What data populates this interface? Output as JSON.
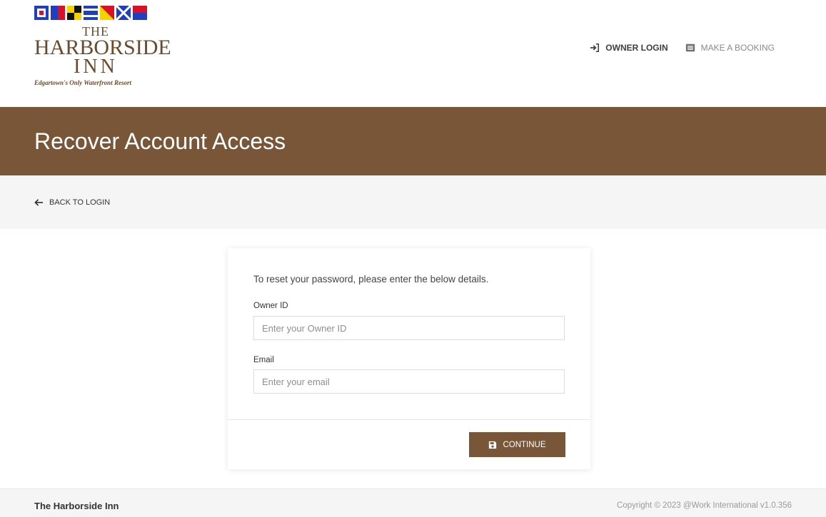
{
  "colors": {
    "brand": "#7a5638",
    "text": "#333333",
    "muted": "#8a8a8a",
    "backbar": "#f5f5f5"
  },
  "logo": {
    "line_the": "THE",
    "line_name": "HARBORSIDE",
    "line_inn": "INN",
    "tagline": "Edgartown's Only Waterfront Resort"
  },
  "nav": {
    "owner_login": {
      "label": "OWNER LOGIN",
      "icon": "sign-in-icon"
    },
    "make_booking": {
      "label": "MAKE A BOOKING",
      "icon": "list-alt-icon"
    }
  },
  "banner": {
    "title": "Recover Account Access"
  },
  "back": {
    "label": "BACK TO LOGIN",
    "icon": "arrow-left-icon"
  },
  "form": {
    "intro": "To reset your password, please enter the below details.",
    "owner_id": {
      "label": "Owner ID",
      "placeholder": "Enter your Owner ID",
      "value": ""
    },
    "email": {
      "label": "Email",
      "placeholder": "Enter your email",
      "value": ""
    },
    "continue": {
      "label": "CONTINUE",
      "icon": "save-icon"
    }
  },
  "footer": {
    "brand": "The Harborside Inn",
    "copyright": "Copyright © 2023 @Work International v1.0.356"
  }
}
